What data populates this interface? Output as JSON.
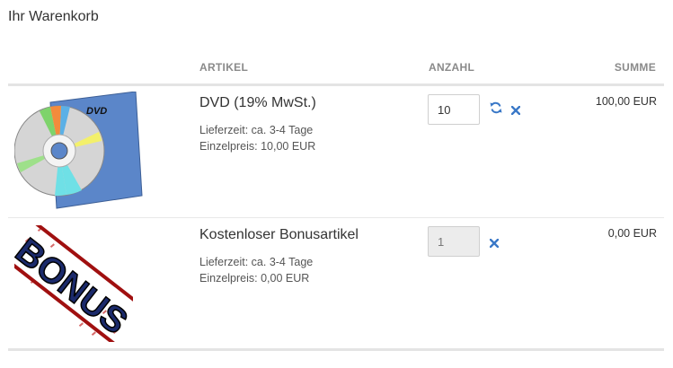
{
  "page": {
    "title": "Ihr Warenkorb"
  },
  "table": {
    "headers": {
      "artikel": "ARTIKEL",
      "anzahl": "ANZAHL",
      "summe": "SUMME"
    }
  },
  "items": [
    {
      "name": "DVD (19% MwSt.)",
      "lieferzeit": "Lieferzeit: ca. 3-4 Tage",
      "einzelpreis": "Einzelpreis: 10,00 EUR",
      "quantity": "10",
      "sum": "100,00 EUR",
      "image_label": "DVD",
      "icons": [
        "refresh-icon",
        "remove-icon"
      ]
    },
    {
      "name": "Kostenloser Bonusartikel",
      "lieferzeit": "Lieferzeit: ca. 3-4 Tage",
      "einzelpreis": "Einzelpreis: 0,00 EUR",
      "quantity": "1",
      "sum": "0,00 EUR",
      "image_label": "BONUS",
      "icons": [
        "remove-icon"
      ]
    }
  ],
  "colors": {
    "icon_blue": "#3a78c7",
    "header_gray": "#8a8a8a"
  }
}
